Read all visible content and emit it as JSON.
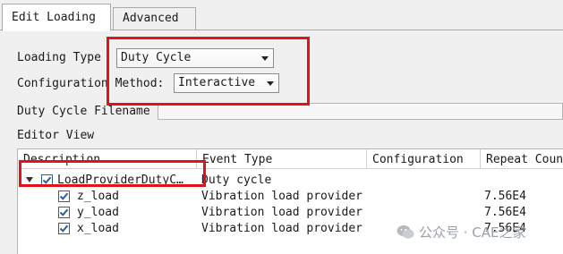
{
  "tabs": [
    {
      "label": "Edit Loading",
      "active": true
    },
    {
      "label": "Advanced",
      "active": false
    }
  ],
  "form": {
    "loading_type_label": "Loading Type",
    "loading_type_value": "Duty Cycle",
    "config_method_label": "Configuration Method:",
    "config_method_value": "Interactive",
    "duty_cycle_filename_label": "Duty Cycle Filename",
    "duty_cycle_filename_value": ""
  },
  "editor_view": {
    "label": "Editor View",
    "columns": [
      "Description",
      "Event Type",
      "Configuration",
      "Repeat Count"
    ],
    "parent_row": {
      "description": "LoadProviderDutyC…",
      "event_type": "Duty cycle",
      "configuration": "",
      "repeat_count": "",
      "checked": true,
      "expanded": true
    },
    "child_rows": [
      {
        "description": "z_load",
        "event_type": "Vibration load provider",
        "configuration": "",
        "repeat_count": "7.56E4",
        "checked": true
      },
      {
        "description": "y_load",
        "event_type": "Vibration load provider",
        "configuration": "",
        "repeat_count": "7.56E4",
        "checked": true
      },
      {
        "description": "x_load",
        "event_type": "Vibration load provider",
        "configuration": "",
        "repeat_count": "7.56E4",
        "checked": true
      }
    ]
  },
  "watermark": {
    "text": "公众号 · CAE之家",
    "icon": "wechat-icon"
  },
  "colors": {
    "highlight": "#e0131a",
    "check": "#2f5f9a"
  }
}
